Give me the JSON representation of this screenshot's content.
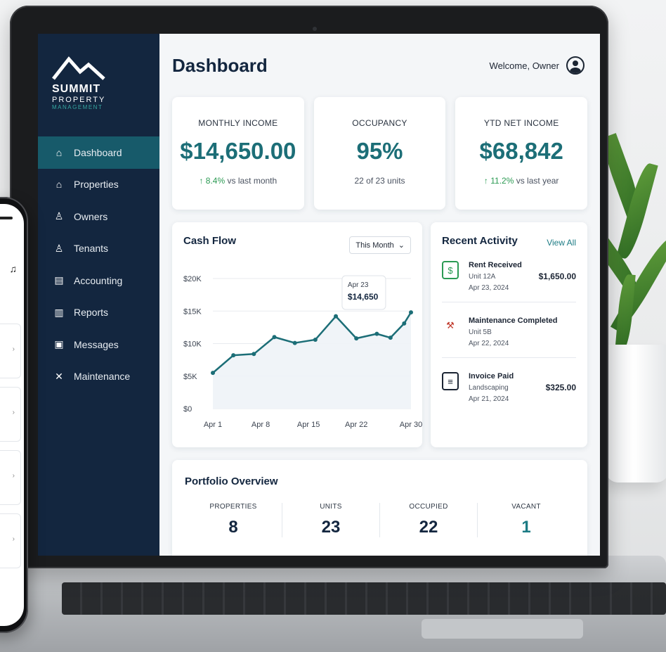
{
  "brand": {
    "name": "SUMMIT",
    "line2": "PROPERTY",
    "line3": "MANAGEMENT"
  },
  "sidebar": {
    "items": [
      {
        "label": "Dashboard",
        "icon": "home-icon",
        "active": true
      },
      {
        "label": "Properties",
        "icon": "building-icon",
        "active": false
      },
      {
        "label": "Owners",
        "icon": "owner-icon",
        "active": false
      },
      {
        "label": "Tenants",
        "icon": "tenant-icon",
        "active": false
      },
      {
        "label": "Accounting",
        "icon": "ledger-icon",
        "active": false
      },
      {
        "label": "Reports",
        "icon": "report-icon",
        "active": false
      },
      {
        "label": "Messages",
        "icon": "message-icon",
        "active": false
      },
      {
        "label": "Maintenance",
        "icon": "tools-icon",
        "active": false
      }
    ]
  },
  "header": {
    "title": "Dashboard",
    "welcome": "Welcome, Owner"
  },
  "stats": [
    {
      "label": "MONTHLY INCOME",
      "value": "$14,650.00",
      "change": "↑ 8.4%",
      "suffix": " vs last month"
    },
    {
      "label": "OCCUPANCY",
      "value": "95%",
      "change": "",
      "suffix": "22 of 23 units"
    },
    {
      "label": "YTD NET INCOME",
      "value": "$68,842",
      "change": "↑ 11.2%",
      "suffix": " vs last year"
    }
  ],
  "cashflow": {
    "title": "Cash Flow",
    "range": "This Month",
    "tooltip_date": "Apr 23",
    "tooltip_value": "$14,650"
  },
  "chart_data": {
    "type": "line",
    "title": "Cash Flow",
    "x_ticks": [
      "Apr 1",
      "Apr 8",
      "Apr 15",
      "Apr 22",
      "Apr 30"
    ],
    "y_ticks": [
      "$0",
      "$5K",
      "$10K",
      "$15K",
      "$20K"
    ],
    "ylim": [
      0,
      20000
    ],
    "x": [
      1,
      4,
      7,
      10,
      13,
      16,
      19,
      22,
      25,
      27,
      29,
      30
    ],
    "values": [
      5500,
      8200,
      8400,
      11000,
      10100,
      10600,
      14200,
      10800,
      11500,
      10900,
      13100,
      14800
    ],
    "highlight": {
      "label": "Apr 23",
      "value": 14650
    },
    "grid": true,
    "line_color": "#1c6e77"
  },
  "activity": {
    "title": "Recent Activity",
    "view_all": "View All",
    "items": [
      {
        "title": "Rent Received",
        "line1": "Unit 12A",
        "line2": "Apr 23, 2024",
        "amount": "$1,650.00",
        "icon": "rent-icon"
      },
      {
        "title": "Maintenance Completed",
        "line1": "Unit 5B",
        "line2": "Apr 22, 2024",
        "amount": "",
        "icon": "wrench-icon"
      },
      {
        "title": "Invoice Paid",
        "line1": "Landscaping",
        "line2": "Apr 21, 2024",
        "amount": "$325.00",
        "icon": "invoice-icon"
      }
    ]
  },
  "portfolio": {
    "title": "Portfolio Overview",
    "metrics": [
      {
        "label": "PROPERTIES",
        "value": "8"
      },
      {
        "label": "UNITS",
        "value": "23"
      },
      {
        "label": "OCCUPIED",
        "value": "22"
      },
      {
        "label": "VACANT",
        "value": "1"
      }
    ]
  },
  "colors": {
    "sidebar": "#13263f",
    "accent": "#1c6e77",
    "positive": "#2b9a53"
  }
}
